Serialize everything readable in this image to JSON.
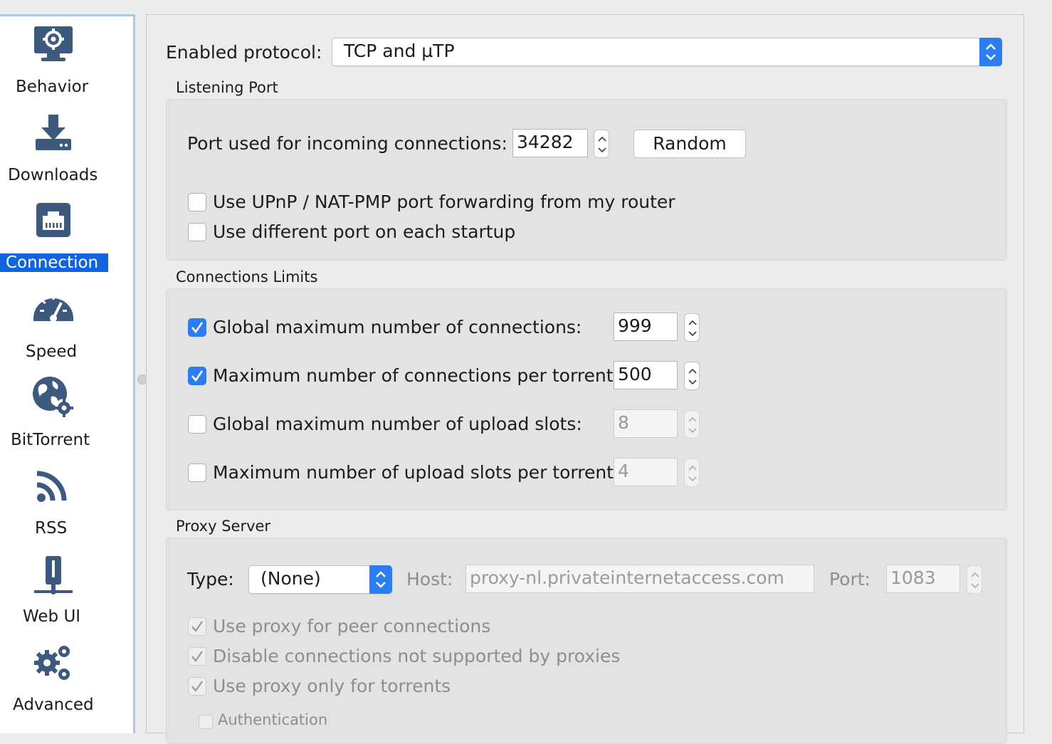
{
  "sidebar": {
    "items": [
      {
        "label": "Behavior",
        "icon": "monitor-gear-icon"
      },
      {
        "label": "Downloads",
        "icon": "download-tray-icon"
      },
      {
        "label": "Connection",
        "icon": "ethernet-port-icon",
        "selected": true
      },
      {
        "label": "Speed",
        "icon": "speedometer-icon"
      },
      {
        "label": "BitTorrent",
        "icon": "globe-gear-icon"
      },
      {
        "label": "RSS",
        "icon": "rss-icon"
      },
      {
        "label": "Web UI",
        "icon": "network-plug-icon"
      },
      {
        "label": "Advanced",
        "icon": "gears-icon"
      }
    ]
  },
  "protocol": {
    "label": "Enabled protocol:",
    "value": "TCP and µTP"
  },
  "listening_port": {
    "title": "Listening Port",
    "port_label": "Port used for incoming connections:",
    "port_value": "34282",
    "random_button": "Random",
    "upnp_label": "Use UPnP / NAT-PMP port forwarding from my router",
    "upnp_checked": false,
    "random_startup_label": "Use different port on each startup",
    "random_startup_checked": false
  },
  "connection_limits": {
    "title": "Connections Limits",
    "rows": [
      {
        "label": "Global maximum number of connections:",
        "value": "999",
        "checked": true
      },
      {
        "label": "Maximum number of connections per torrent:",
        "value": "500",
        "checked": true
      },
      {
        "label": "Global maximum number of upload slots:",
        "value": "8",
        "checked": false
      },
      {
        "label": "Maximum number of upload slots per torrent:",
        "value": "4",
        "checked": false
      }
    ]
  },
  "proxy": {
    "title": "Proxy Server",
    "type_label": "Type:",
    "type_value": "(None)",
    "host_label": "Host:",
    "host_value": "proxy-nl.privateinternetaccess.com",
    "port_label": "Port:",
    "port_value": "1083",
    "options": [
      {
        "label": "Use proxy for peer connections",
        "checked": true
      },
      {
        "label": "Disable connections not supported by proxies",
        "checked": true
      },
      {
        "label": "Use proxy only for torrents",
        "checked": true
      }
    ],
    "auth_label": "Authentication",
    "auth_checked": false
  },
  "colors": {
    "accent": "#2d7df2",
    "selection": "#1064e0",
    "icon": "#3d5a7e"
  }
}
